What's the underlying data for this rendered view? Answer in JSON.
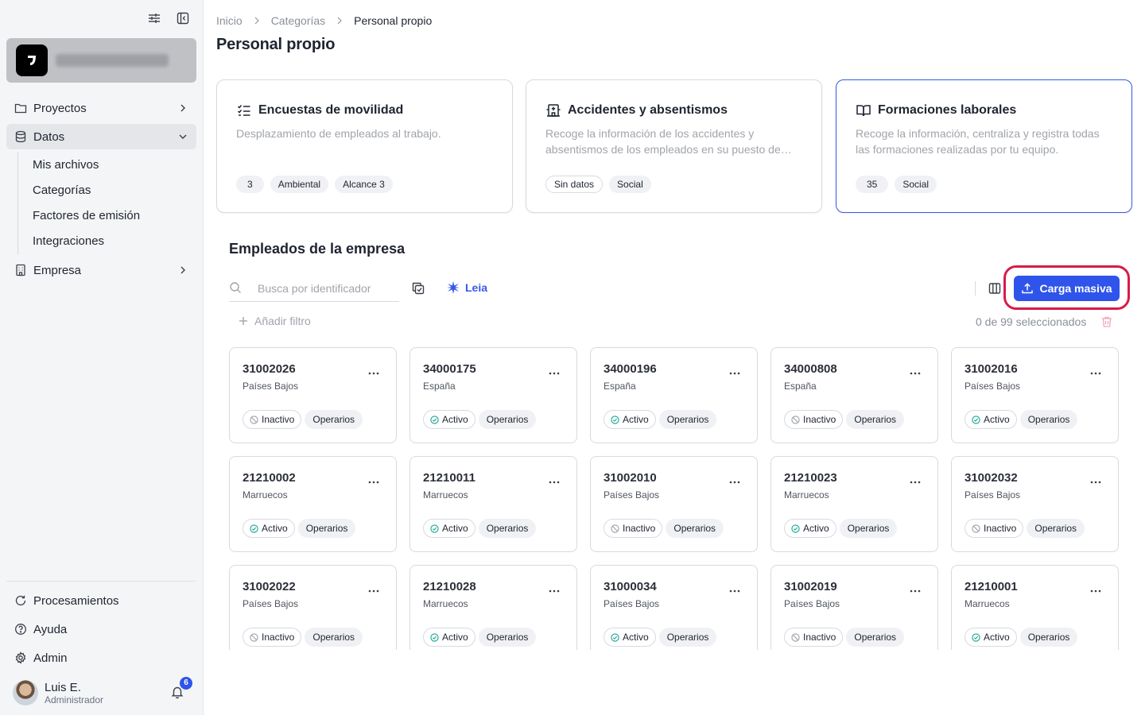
{
  "sidebar": {
    "nav": [
      {
        "label": "Proyectos",
        "icon": "folder-icon"
      },
      {
        "label": "Datos",
        "icon": "database-icon"
      },
      {
        "label": "Empresa",
        "icon": "building-icon"
      }
    ],
    "subnav": [
      "Mis archivos",
      "Categorías",
      "Factores de emisión",
      "Integraciones"
    ],
    "bottom": [
      {
        "label": "Procesamientos",
        "icon": "refresh-icon"
      },
      {
        "label": "Ayuda",
        "icon": "help-icon"
      },
      {
        "label": "Admin",
        "icon": "gear-icon"
      }
    ],
    "user": {
      "name": "Luis E.",
      "role": "Administrador",
      "notifications": "6"
    }
  },
  "breadcrumb": [
    "Inicio",
    "Categorías",
    "Personal propio"
  ],
  "page_title": "Personal propio",
  "categories": [
    {
      "title": "Encuestas de movilidad",
      "icon": "checklist-icon",
      "description": "Desplazamiento de empleados al trabajo.",
      "tags": [
        "3",
        "Ambiental",
        "Alcance 3"
      ]
    },
    {
      "title": "Accidentes y absentismos",
      "icon": "hospital-icon",
      "description": "Recoge la información de los accidentes y absentismos de los empleados en su puesto de trabajo.",
      "tags": [
        "Sin datos",
        "Social"
      ]
    },
    {
      "title": "Formaciones laborales",
      "icon": "book-icon",
      "description": "Recoge la información, centraliza y registra todas las formaciones realizadas por tu equipo.",
      "tags": [
        "35",
        "Social"
      ]
    }
  ],
  "section_title": "Empleados de la empresa",
  "search": {
    "placeholder": "Busca por identificador"
  },
  "leia_label": "Leia",
  "upload_label": "Carga masiva",
  "add_filter_label": "Añadir filtro",
  "selection_text": "0 de 99 seleccionados",
  "colors": {
    "accent": "#2f54eb",
    "highlight": "#d81b48",
    "active_status": "#16a394"
  },
  "employees": [
    {
      "id": "31002026",
      "country": "Países Bajos",
      "status": "Inactivo",
      "role": "Operarios"
    },
    {
      "id": "34000175",
      "country": "España",
      "status": "Activo",
      "role": "Operarios"
    },
    {
      "id": "34000196",
      "country": "España",
      "status": "Activo",
      "role": "Operarios"
    },
    {
      "id": "34000808",
      "country": "España",
      "status": "Inactivo",
      "role": "Operarios"
    },
    {
      "id": "31002016",
      "country": "Países Bajos",
      "status": "Activo",
      "role": "Operarios"
    },
    {
      "id": "21210002",
      "country": "Marruecos",
      "status": "Activo",
      "role": "Operarios"
    },
    {
      "id": "21210011",
      "country": "Marruecos",
      "status": "Activo",
      "role": "Operarios"
    },
    {
      "id": "31002010",
      "country": "Países Bajos",
      "status": "Inactivo",
      "role": "Operarios"
    },
    {
      "id": "21210023",
      "country": "Marruecos",
      "status": "Activo",
      "role": "Operarios"
    },
    {
      "id": "31002032",
      "country": "Países Bajos",
      "status": "Inactivo",
      "role": "Operarios"
    },
    {
      "id": "31002022",
      "country": "Países Bajos",
      "status": "Inactivo",
      "role": "Operarios"
    },
    {
      "id": "21210028",
      "country": "Marruecos",
      "status": "Activo",
      "role": "Operarios"
    },
    {
      "id": "31000034",
      "country": "Países Bajos",
      "status": "Activo",
      "role": "Operarios"
    },
    {
      "id": "31002019",
      "country": "Países Bajos",
      "status": "Inactivo",
      "role": "Operarios"
    },
    {
      "id": "21210001",
      "country": "Marruecos",
      "status": "Activo",
      "role": "Operarios"
    }
  ]
}
